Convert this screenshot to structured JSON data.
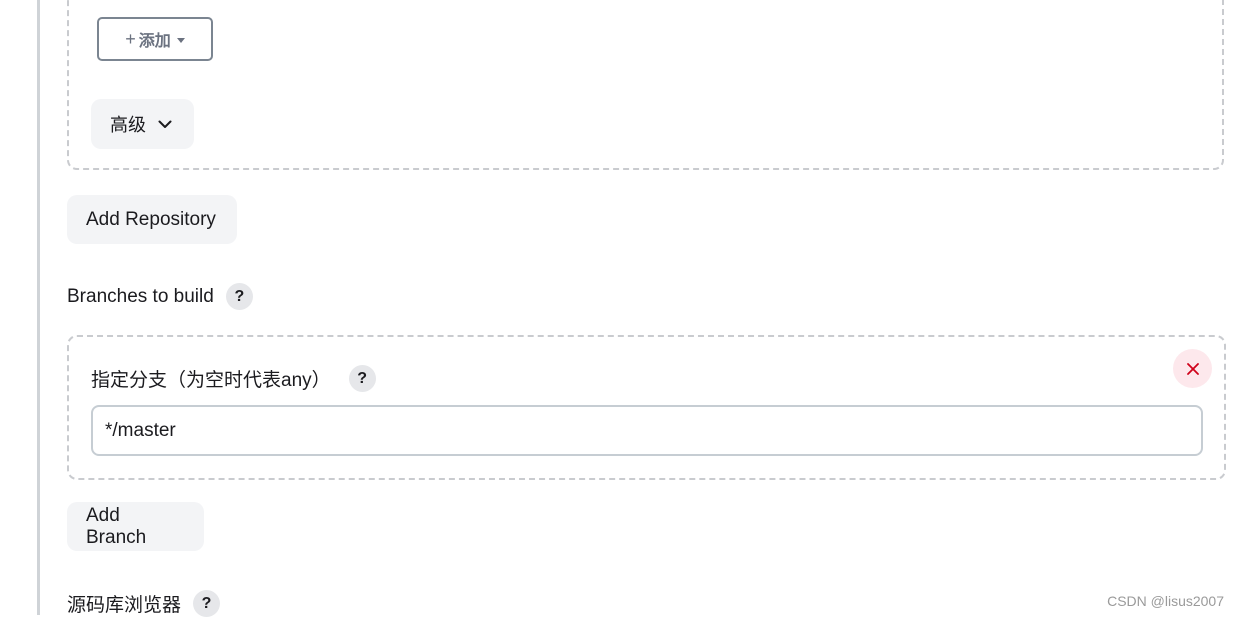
{
  "repository": {
    "add_button_label": "添加",
    "advanced_label": "高级"
  },
  "add_repository_label": "Add Repository",
  "branches": {
    "section_label": "Branches to build",
    "specifier_label": "指定分支（为空时代表any）",
    "specifier_value": "*/master",
    "add_branch_label": "Add Branch"
  },
  "repo_browser": {
    "section_label": "源码库浏览器"
  },
  "help_glyph": "?",
  "watermark": "CSDN @lisus2007",
  "colors": {
    "danger": "#d0021b",
    "danger_bg": "#fde8ec",
    "button_bg": "#f3f4f6",
    "dashed_border": "#c9cbcf"
  }
}
